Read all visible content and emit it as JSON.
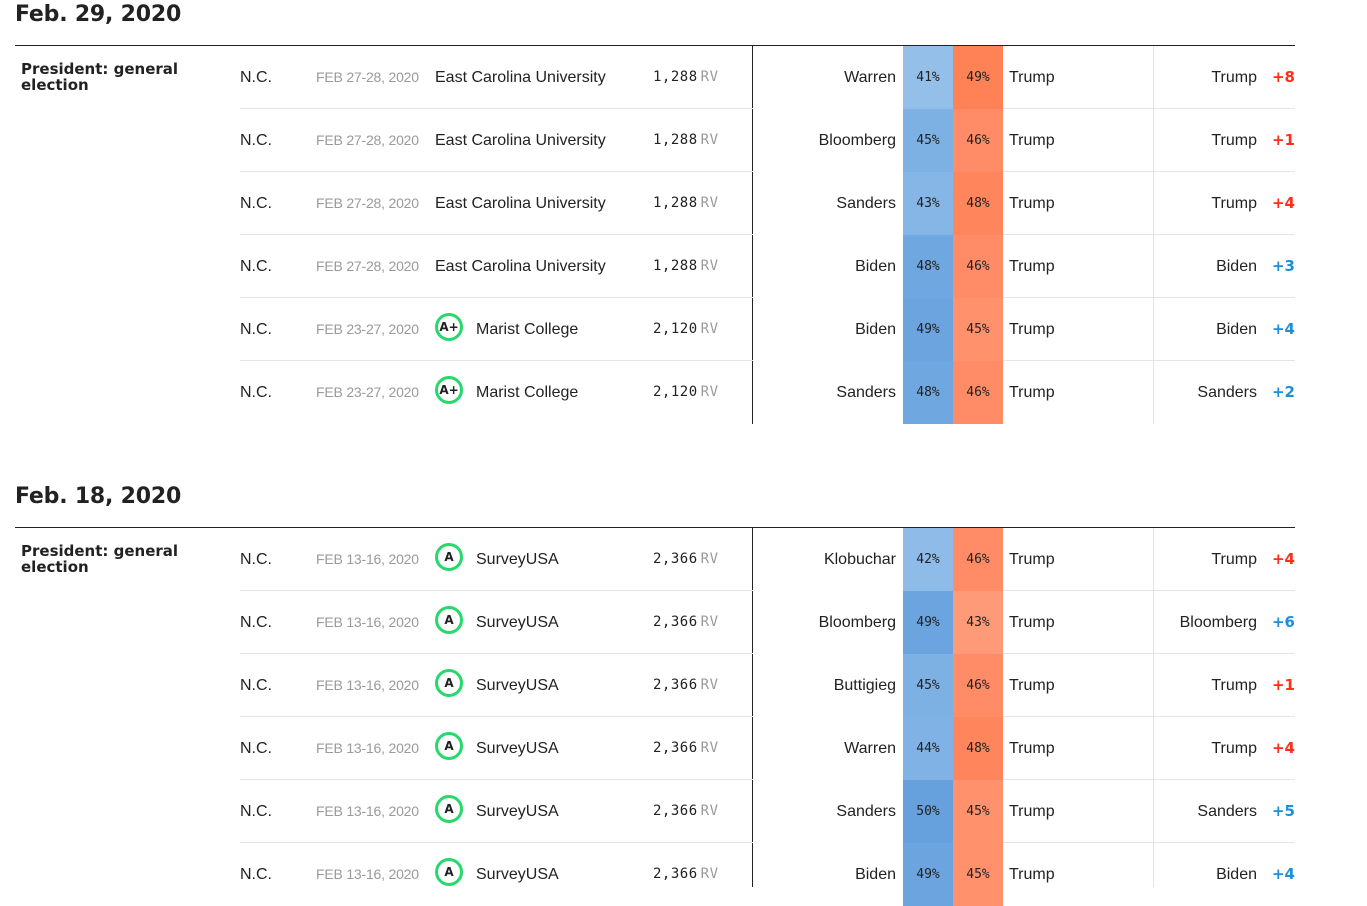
{
  "colors": {
    "dem_shades": {
      "41": "#94bfe9",
      "42": "#8fbbe8",
      "43": "#86b6e6",
      "44": "#80b2e5",
      "45": "#7db0e3",
      "48": "#6fa7e0",
      "49": "#6ba4df",
      "50": "#66a1dd"
    },
    "rep_shades": {
      "43": "#ff9a78",
      "45": "#ff916c",
      "46": "#ff8c66",
      "48": "#ff855d",
      "49": "#ff8156"
    },
    "rep_margin": "#ff2d1a",
    "dem_margin": "#1e8fd6",
    "grade_ring": "#27d96c"
  },
  "groups": [
    {
      "date": "Feb. 29, 2020",
      "race": "President: general election",
      "rows": [
        {
          "state": "N.C.",
          "dates": "FEB 27-28, 2020",
          "grade": "",
          "pollster": "East Carolina University",
          "sample": "1,288",
          "population": "RV",
          "dem": "Warren",
          "dem_pct": "41%",
          "dem_val": 41,
          "rep_pct": "49%",
          "rep_val": 49,
          "rep": "Trump",
          "leader": "Trump",
          "margin": "+8",
          "margin_party": "rep"
        },
        {
          "state": "N.C.",
          "dates": "FEB 27-28, 2020",
          "grade": "",
          "pollster": "East Carolina University",
          "sample": "1,288",
          "population": "RV",
          "dem": "Bloomberg",
          "dem_pct": "45%",
          "dem_val": 45,
          "rep_pct": "46%",
          "rep_val": 46,
          "rep": "Trump",
          "leader": "Trump",
          "margin": "+1",
          "margin_party": "rep"
        },
        {
          "state": "N.C.",
          "dates": "FEB 27-28, 2020",
          "grade": "",
          "pollster": "East Carolina University",
          "sample": "1,288",
          "population": "RV",
          "dem": "Sanders",
          "dem_pct": "43%",
          "dem_val": 43,
          "rep_pct": "48%",
          "rep_val": 48,
          "rep": "Trump",
          "leader": "Trump",
          "margin": "+4",
          "margin_party": "rep"
        },
        {
          "state": "N.C.",
          "dates": "FEB 27-28, 2020",
          "grade": "",
          "pollster": "East Carolina University",
          "sample": "1,288",
          "population": "RV",
          "dem": "Biden",
          "dem_pct": "48%",
          "dem_val": 48,
          "rep_pct": "46%",
          "rep_val": 46,
          "rep": "Trump",
          "leader": "Biden",
          "margin": "+3",
          "margin_party": "dem"
        },
        {
          "state": "N.C.",
          "dates": "FEB 23-27, 2020",
          "grade": "A+",
          "pollster": "Marist College",
          "sample": "2,120",
          "population": "RV",
          "dem": "Biden",
          "dem_pct": "49%",
          "dem_val": 49,
          "rep_pct": "45%",
          "rep_val": 45,
          "rep": "Trump",
          "leader": "Biden",
          "margin": "+4",
          "margin_party": "dem"
        },
        {
          "state": "N.C.",
          "dates": "FEB 23-27, 2020",
          "grade": "A+",
          "pollster": "Marist College",
          "sample": "2,120",
          "population": "RV",
          "dem": "Sanders",
          "dem_pct": "48%",
          "dem_val": 48,
          "rep_pct": "46%",
          "rep_val": 46,
          "rep": "Trump",
          "leader": "Sanders",
          "margin": "+2",
          "margin_party": "dem"
        }
      ]
    },
    {
      "date": "Feb. 18, 2020",
      "race": "President: general election",
      "rows": [
        {
          "state": "N.C.",
          "dates": "FEB 13-16, 2020",
          "grade": "A",
          "pollster": "SurveyUSA",
          "sample": "2,366",
          "population": "RV",
          "dem": "Klobuchar",
          "dem_pct": "42%",
          "dem_val": 42,
          "rep_pct": "46%",
          "rep_val": 46,
          "rep": "Trump",
          "leader": "Trump",
          "margin": "+4",
          "margin_party": "rep"
        },
        {
          "state": "N.C.",
          "dates": "FEB 13-16, 2020",
          "grade": "A",
          "pollster": "SurveyUSA",
          "sample": "2,366",
          "population": "RV",
          "dem": "Bloomberg",
          "dem_pct": "49%",
          "dem_val": 49,
          "rep_pct": "43%",
          "rep_val": 43,
          "rep": "Trump",
          "leader": "Bloomberg",
          "margin": "+6",
          "margin_party": "dem"
        },
        {
          "state": "N.C.",
          "dates": "FEB 13-16, 2020",
          "grade": "A",
          "pollster": "SurveyUSA",
          "sample": "2,366",
          "population": "RV",
          "dem": "Buttigieg",
          "dem_pct": "45%",
          "dem_val": 45,
          "rep_pct": "46%",
          "rep_val": 46,
          "rep": "Trump",
          "leader": "Trump",
          "margin": "+1",
          "margin_party": "rep"
        },
        {
          "state": "N.C.",
          "dates": "FEB 13-16, 2020",
          "grade": "A",
          "pollster": "SurveyUSA",
          "sample": "2,366",
          "population": "RV",
          "dem": "Warren",
          "dem_pct": "44%",
          "dem_val": 44,
          "rep_pct": "48%",
          "rep_val": 48,
          "rep": "Trump",
          "leader": "Trump",
          "margin": "+4",
          "margin_party": "rep"
        },
        {
          "state": "N.C.",
          "dates": "FEB 13-16, 2020",
          "grade": "A",
          "pollster": "SurveyUSA",
          "sample": "2,366",
          "population": "RV",
          "dem": "Sanders",
          "dem_pct": "50%",
          "dem_val": 50,
          "rep_pct": "45%",
          "rep_val": 45,
          "rep": "Trump",
          "leader": "Sanders",
          "margin": "+5",
          "margin_party": "dem"
        },
        {
          "state": "N.C.",
          "dates": "FEB 13-16, 2020",
          "grade": "A",
          "pollster": "SurveyUSA",
          "sample": "2,366",
          "population": "RV",
          "dem": "Biden",
          "dem_pct": "49%",
          "dem_val": 49,
          "rep_pct": "45%",
          "rep_val": 45,
          "rep": "Trump",
          "leader": "Biden",
          "margin": "+4",
          "margin_party": "dem"
        }
      ]
    }
  ]
}
